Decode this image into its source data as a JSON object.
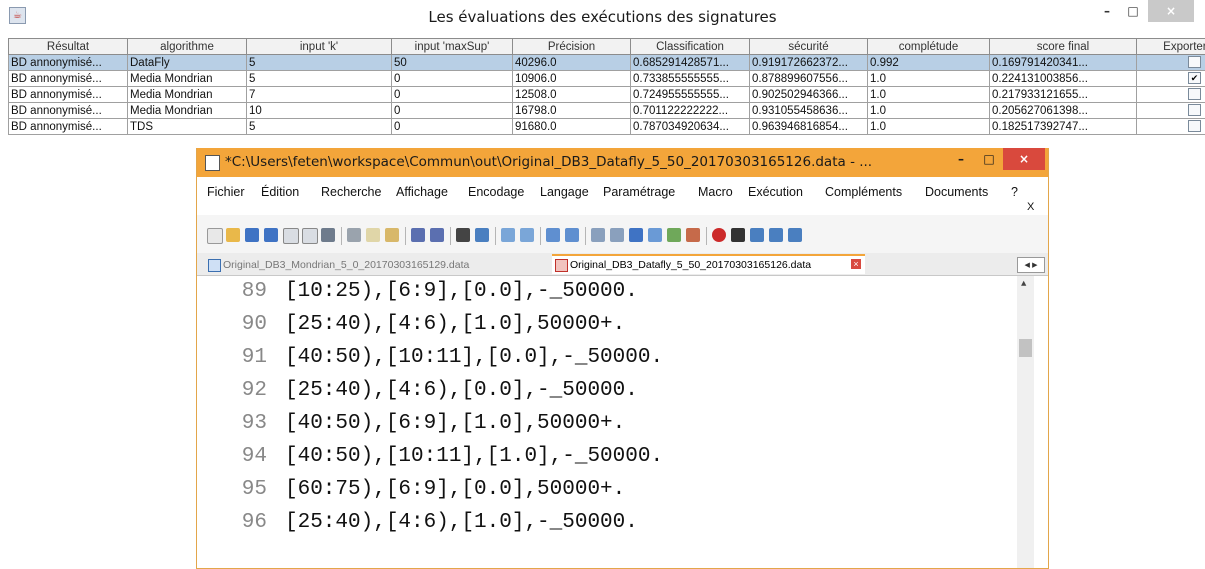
{
  "window": {
    "title": "Les évaluations des exécutions des signatures",
    "min_label": "–",
    "max_label": "□",
    "close_label": "×"
  },
  "table": {
    "columns": [
      "Résultat",
      "algorithme",
      "input 'k'",
      "input 'maxSup'",
      "Précision",
      "Classification",
      "sécurité",
      "complétude",
      "score final",
      "Exporter BD"
    ],
    "rows": [
      {
        "resultat": "BD annonymisé...",
        "algo": "DataFly",
        "k": "5",
        "maxsup": "50",
        "precision": "40296.0",
        "classification": "0.685291428571...",
        "securite": "0.919172662372...",
        "completude": "0.992",
        "score": "0.169791420341...",
        "export": false
      },
      {
        "resultat": "BD annonymisé...",
        "algo": "Media Mondrian",
        "k": "5",
        "maxsup": "0",
        "precision": "10906.0",
        "classification": "0.733855555555...",
        "securite": "0.878899607556...",
        "completude": "1.0",
        "score": "0.224131003856...",
        "export": true
      },
      {
        "resultat": "BD annonymisé...",
        "algo": "Media Mondrian",
        "k": "7",
        "maxsup": "0",
        "precision": "12508.0",
        "classification": "0.724955555555...",
        "securite": "0.902502946366...",
        "completude": "1.0",
        "score": "0.217933121655...",
        "export": false
      },
      {
        "resultat": "BD annonymisé...",
        "algo": "Media Mondrian",
        "k": "10",
        "maxsup": "0",
        "precision": "16798.0",
        "classification": "0.701122222222...",
        "securite": "0.931055458636...",
        "completude": "1.0",
        "score": "0.205627061398...",
        "export": false
      },
      {
        "resultat": "BD annonymisé...",
        "algo": "TDS",
        "k": "5",
        "maxsup": "0",
        "precision": "91680.0",
        "classification": "0.787034920634...",
        "securite": "0.963946816854...",
        "completude": "1.0",
        "score": "0.182517392747...",
        "export": false
      }
    ],
    "checked_mark": "✔"
  },
  "notepad": {
    "title": "*C:\\Users\\feten\\workspace\\Commun\\out\\Original_DB3_Datafly_5_50_20170303165126.data - ...",
    "min_label": "–",
    "max_label": "□",
    "close_label": "×",
    "menu": [
      "Fichier",
      "Édition",
      "Recherche",
      "Affichage",
      "Encodage",
      "Langage",
      "Paramétrage",
      "Macro",
      "Exécution",
      "Compléments",
      "Documents",
      "?"
    ],
    "menu_close": "X",
    "tabs": [
      {
        "label": "Original_DB3_Mondrian_5_0_20170303165129.data",
        "close": "×"
      },
      {
        "label": "Original_DB3_Datafly_5_50_20170303165126.data",
        "close": "×"
      }
    ],
    "tab_nav": "◀ ▶",
    "lines": [
      {
        "num": "89",
        "text": "[10:25),[6:9],[0.0],-_50000."
      },
      {
        "num": "90",
        "text": "[25:40),[4:6),[1.0],50000+."
      },
      {
        "num": "91",
        "text": "[40:50),[10:11],[0.0],-_50000."
      },
      {
        "num": "92",
        "text": "[25:40),[4:6),[0.0],-_50000."
      },
      {
        "num": "93",
        "text": "[40:50),[6:9],[1.0],50000+."
      },
      {
        "num": "94",
        "text": "[40:50),[10:11],[1.0],-_50000."
      },
      {
        "num": "95",
        "text": "[60:75),[6:9],[0.0],50000+."
      },
      {
        "num": "96",
        "text": "[25:40),[4:6),[1.0],-_50000."
      }
    ]
  }
}
